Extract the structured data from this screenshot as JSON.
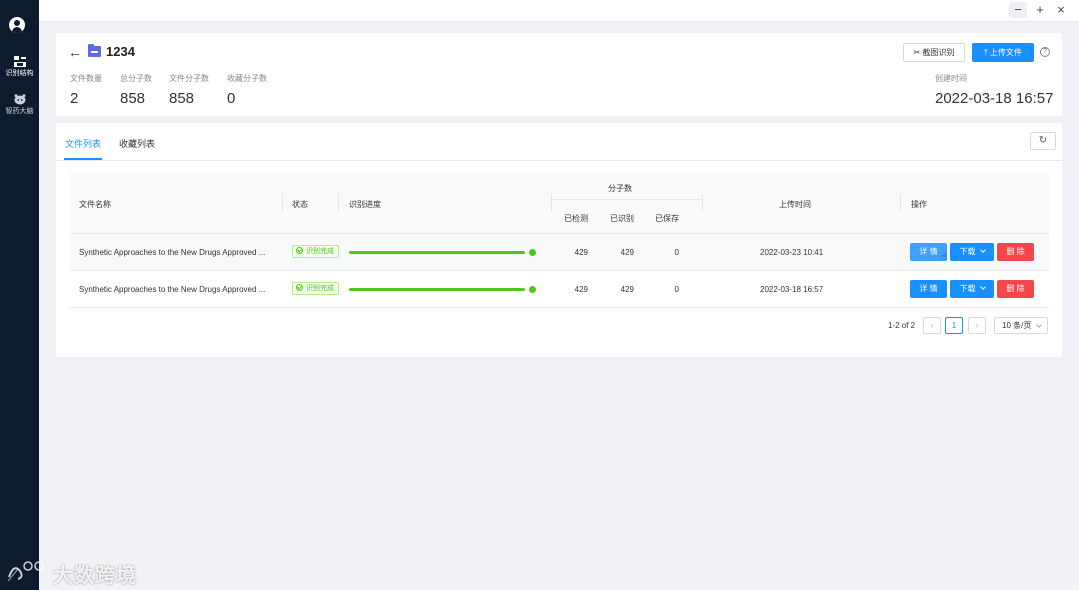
{
  "sidebar": {
    "items": [
      {
        "label": "识别结构",
        "icon": "structure-icon"
      },
      {
        "label": "智药大脑",
        "icon": "brain-icon"
      }
    ]
  },
  "window": {
    "minimize": "−",
    "maximize": "+",
    "close": "×"
  },
  "header": {
    "title": "1234",
    "stats": [
      {
        "label": "文件数量",
        "value": "2"
      },
      {
        "label": "总分子数",
        "value": "858"
      },
      {
        "label": "文件分子数",
        "value": "858"
      },
      {
        "label": "收藏分子数",
        "value": "0"
      }
    ],
    "created_label": "创建时间",
    "created_value": "2022-03-18 16:57",
    "crop_button": "截图识别",
    "upload_button": "上传文件",
    "help": "?"
  },
  "tabs": [
    {
      "label": "文件列表",
      "active": true
    },
    {
      "label": "收藏列表",
      "active": false
    }
  ],
  "table": {
    "columns": {
      "name": "文件名称",
      "status": "状态",
      "progress": "识别进度",
      "molecules": "分子数",
      "detected": "已检测",
      "recognized": "已识别",
      "saved": "已保存",
      "upload_time": "上传时间",
      "actions": "操作"
    },
    "rows": [
      {
        "name": "Synthetic Approaches to the New Drugs Approved ...",
        "status": "识别完成",
        "progress_pct": 100,
        "detected": "429",
        "recognized": "429",
        "saved": "0",
        "upload_time": "2022-03-23 10:41",
        "detail": "详 情",
        "download": "下载",
        "delete": "删 除"
      },
      {
        "name": "Synthetic Approaches to the New Drugs Approved ...",
        "status": "识别完成",
        "progress_pct": 100,
        "detected": "429",
        "recognized": "429",
        "saved": "0",
        "upload_time": "2022-03-18 16:57",
        "detail": "详 情",
        "download": "下载",
        "delete": "删 除"
      }
    ]
  },
  "pagination": {
    "total": "1-2 of 2",
    "prev": "‹",
    "current": "1",
    "next": "›",
    "page_size": "10 条/页"
  },
  "watermark": "大数跨境",
  "colors": {
    "primary": "#1890ff",
    "danger": "#f5464b",
    "success": "#52c41a",
    "sidebar": "#0c1b2e"
  }
}
